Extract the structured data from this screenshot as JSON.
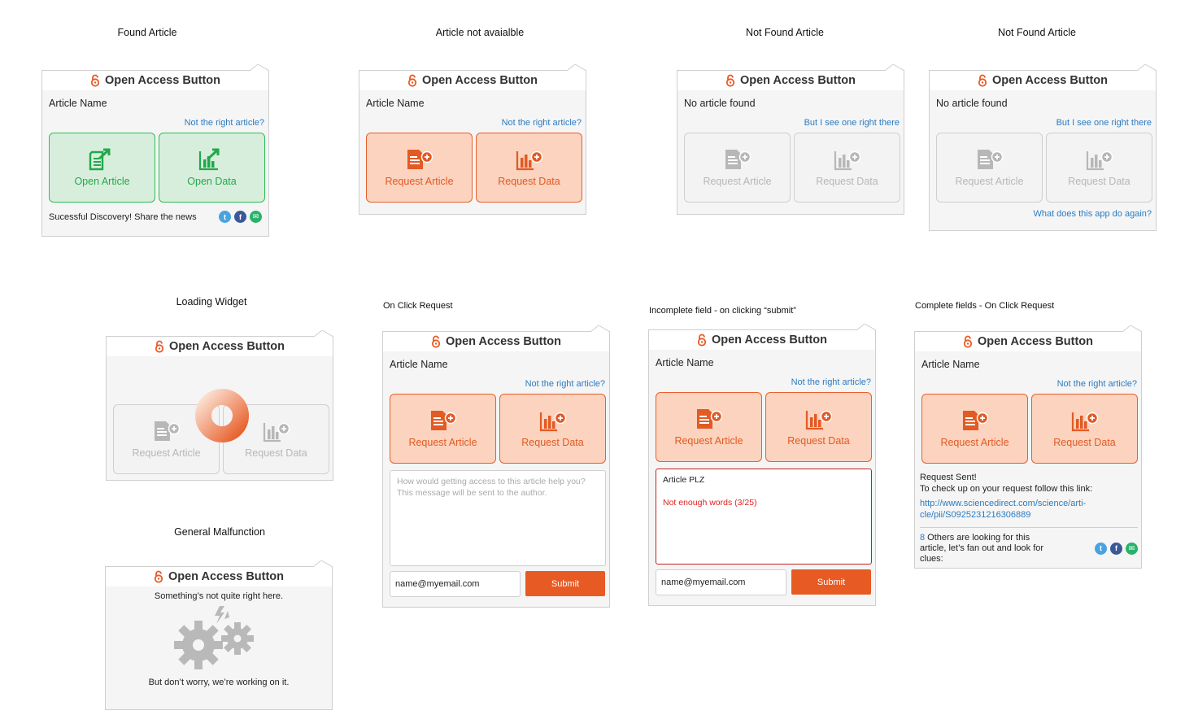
{
  "brand": "Open Access Button",
  "colors": {
    "orange": "#e85a24",
    "green": "#22a84a",
    "link": "#2b7bc0",
    "grey": "#b7b7b7"
  },
  "captions": {
    "found": "Found Article",
    "not_available": "Article not avaialble",
    "not_found_1": "Not Found Article",
    "not_found_2": "Not Found Article",
    "loading": "Loading Widget",
    "on_click": "On Click Request",
    "incomplete": "Incomplete field - on clicking “submit”",
    "complete": "Complete fields  - On Click Request",
    "malfunction": "General Malfunction"
  },
  "found": {
    "article_name": "Article Name",
    "link": "Not the right article?",
    "btn1": "Open Article",
    "btn2": "Open Data",
    "share": "Sucessful Discovery! Share the news"
  },
  "not_available": {
    "article_name": "Article Name",
    "link": "Not the right article?",
    "btn1": "Request Article",
    "btn2": "Request Data"
  },
  "not_found_1": {
    "article_name": "No article found",
    "link": "But I see one right there",
    "btn1": "Request Article",
    "btn2": "Request Data"
  },
  "not_found_2": {
    "article_name": "No article found",
    "link": "But I see one right there",
    "btn1": "Request Article",
    "btn2": "Request Data",
    "bottom_link": "What does this app do again?"
  },
  "loading": {
    "btn1": "Request Article",
    "btn2": "Request Data"
  },
  "on_click": {
    "article_name": "Article Name",
    "link": "Not the right article?",
    "btn1": "Request Article",
    "btn2": "Request Data",
    "placeholder": "How would getting access to this article help you? This message will be sent to the author.",
    "email": "name@myemail.com",
    "submit": "Submit"
  },
  "incomplete": {
    "article_name": "Article Name",
    "link": "Not the right article?",
    "btn1": "Request Article",
    "btn2": "Request Data",
    "text": "Article PLZ",
    "error": "Not enough words (3/25)",
    "email": "name@myemail.com",
    "submit": "Submit"
  },
  "complete": {
    "article_name": "Article Name",
    "link": "Not the right article?",
    "btn1": "Request Article",
    "btn2": "Request Data",
    "sent": "Request Sent!",
    "follow": "To check up on your request follow this link:",
    "url": "http://www.sciencedirect.com/science/arti- cle/pii/S0925231216306889",
    "count": "8",
    "others": " Others are looking for this article, let’s fan out and look for clues:"
  },
  "malfunction": {
    "line1": "Something’s not quite right here.",
    "line2": "But don’t worry, we’re working on it."
  }
}
